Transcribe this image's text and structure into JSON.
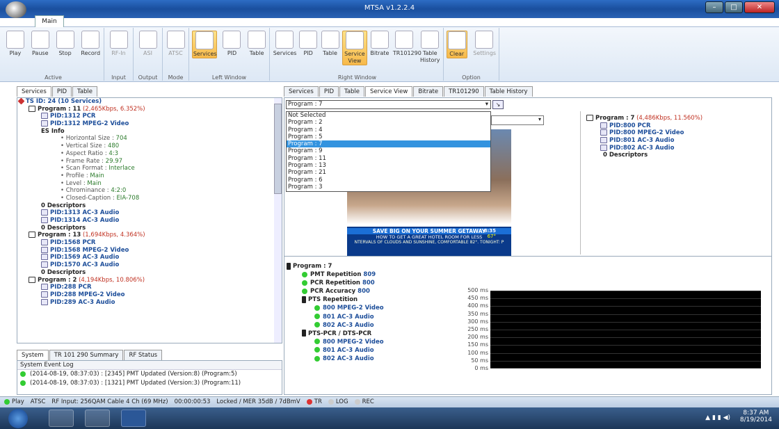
{
  "window": {
    "title": "MTSA v1.2.2.4"
  },
  "ribbon": {
    "main_tab": "Main",
    "groups": [
      {
        "label": "Active",
        "buttons": [
          {
            "label": "Play",
            "icon": "play-icon"
          },
          {
            "label": "Pause",
            "icon": "pause-icon"
          },
          {
            "label": "Stop",
            "icon": "stop-icon"
          },
          {
            "label": "Record",
            "icon": "record-icon"
          }
        ]
      },
      {
        "label": "Input",
        "buttons": [
          {
            "label": "RF-In",
            "icon": "rf-in-icon"
          }
        ]
      },
      {
        "label": "Output",
        "buttons": [
          {
            "label": "ASI",
            "icon": "asi-icon"
          }
        ]
      },
      {
        "label": "Mode",
        "buttons": [
          {
            "label": "ATSC",
            "icon": "atsc-icon"
          }
        ]
      },
      {
        "label": "Left Window",
        "buttons": [
          {
            "label": "Services",
            "icon": "tv-icon"
          },
          {
            "label": "PID",
            "icon": "pid-icon"
          },
          {
            "label": "Table",
            "icon": "table-icon"
          }
        ]
      },
      {
        "label": "Right Window",
        "buttons": [
          {
            "label": "Services",
            "icon": "tv-icon"
          },
          {
            "label": "PID",
            "icon": "pid-icon"
          },
          {
            "label": "Table",
            "icon": "table-icon"
          },
          {
            "label": "Service View",
            "icon": "magnifier-icon"
          },
          {
            "label": "Bitrate",
            "icon": "bar-chart-icon"
          },
          {
            "label": "TR101290",
            "icon": "traffic-light-icon"
          },
          {
            "label": "Table History",
            "icon": "history-icon"
          }
        ]
      },
      {
        "label": "Option",
        "buttons": [
          {
            "label": "Clear",
            "icon": "warning-icon"
          },
          {
            "label": "Settings",
            "icon": "gear-icon"
          }
        ]
      }
    ]
  },
  "left_tabs": [
    "Services",
    "PID",
    "Table"
  ],
  "tree": [
    {
      "t": "TS ID: 24 (10 Services)",
      "k": "ts"
    },
    {
      "t": "Program : 11",
      "r": " (2,465Kbps, 6.352%)",
      "k": "prog"
    },
    {
      "t": "PID:1312 PCR",
      "k": "pid"
    },
    {
      "t": "PID:1312 MPEG-2 Video",
      "k": "pid"
    },
    {
      "t": "ES Info",
      "k": "bold"
    },
    {
      "t": "Horizontal Size : ",
      "v": "704",
      "k": "es"
    },
    {
      "t": "Vertical Size : ",
      "v": "480",
      "k": "es"
    },
    {
      "t": "Aspect Ratio : ",
      "v": "4:3",
      "k": "es"
    },
    {
      "t": "Frame Rate : ",
      "v": "29.97",
      "k": "es"
    },
    {
      "t": "Scan Format : ",
      "v": "Interlace",
      "k": "es"
    },
    {
      "t": "Profile : ",
      "v": "Main",
      "k": "es"
    },
    {
      "t": "Level : ",
      "v": "Main",
      "k": "es"
    },
    {
      "t": "Chrominance : ",
      "v": "4:2:0",
      "k": "es"
    },
    {
      "t": "Closed-Caption : ",
      "v": "EIA-708",
      "k": "es"
    },
    {
      "t": "0 Descriptors",
      "k": "bold"
    },
    {
      "t": "PID:1313 AC-3 Audio",
      "k": "pid"
    },
    {
      "t": "PID:1314 AC-3 Audio",
      "k": "pid"
    },
    {
      "t": "0 Descriptors",
      "k": "bold"
    },
    {
      "t": "Program : 13",
      "r": " (1,694Kbps, 4.364%)",
      "k": "prog"
    },
    {
      "t": "PID:1568 PCR",
      "k": "pid"
    },
    {
      "t": "PID:1568 MPEG-2 Video",
      "k": "pid"
    },
    {
      "t": "PID:1569 AC-3 Audio",
      "k": "pid"
    },
    {
      "t": "PID:1570 AC-3 Audio",
      "k": "pid"
    },
    {
      "t": "0 Descriptors",
      "k": "bold"
    },
    {
      "t": "Program : 2",
      "r": " (4,194Kbps, 10.806%)",
      "k": "prog"
    },
    {
      "t": "PID:288 PCR",
      "k": "pid"
    },
    {
      "t": "PID:288 MPEG-2 Video",
      "k": "pid"
    },
    {
      "t": "PID:289 AC-3 Audio",
      "k": "pid"
    }
  ],
  "log_tabs": [
    "System",
    "TR 101 290 Summary",
    "RF Status"
  ],
  "log_header": "System Event Log",
  "log_rows": [
    "(2014-08-19, 08:37:03) : [2345] PMT Updated (Version:8) (Program:5)",
    "(2014-08-19, 08:37:03) : [1321] PMT Updated (Version:3) (Program:11)"
  ],
  "right_tabs": [
    "Services",
    "PID",
    "Table",
    "Service View",
    "Bitrate",
    "TR101290",
    "Table History"
  ],
  "program_select": {
    "value": "Program : 7",
    "options": [
      "Not Selected",
      "Program : 2",
      "Program : 4",
      "Program : 5",
      "Program : 7",
      "Program : 9",
      "Program : 11",
      "Program : 13",
      "Program : 21",
      "Program : 6",
      "Program : 3"
    ],
    "selected_index": 4
  },
  "video": {
    "banner_line1": "SAVE BIG ON YOUR SUMMER GETAWAY",
    "banner_line2": "HOW TO GET A GREAT HOTEL ROOM FOR LESS",
    "banner_line3": "NTERVALS OF CLOUDS AND SUNSHINE, COMFORTABLE 82°.   TONIGHT: P",
    "time": "8:35",
    "temp": "67°"
  },
  "program_info": [
    {
      "t": "Program : 7",
      "r": " (4,486Kbps, 11.560%)",
      "k": "prog"
    },
    {
      "t": "PID:800 PCR",
      "k": "pid"
    },
    {
      "t": "PID:800 MPEG-2 Video",
      "k": "pid"
    },
    {
      "t": "PID:801 AC-3 Audio",
      "k": "pid"
    },
    {
      "t": "PID:802 AC-3 Audio",
      "k": "pid"
    },
    {
      "t": "0 Descriptors",
      "k": "bold"
    }
  ],
  "tr_tree": [
    {
      "t": "Program : 7",
      "v": ""
    },
    {
      "t": "PMT Repetition ",
      "v": "809"
    },
    {
      "t": "PCR Repetition ",
      "v": "800"
    },
    {
      "t": "PCR Accuracy ",
      "v": "800"
    },
    {
      "t": "PTS Repetition",
      "v": ""
    },
    {
      "t": "",
      "v": "800",
      "s": " MPEG-2 Video"
    },
    {
      "t": "",
      "v": "801",
      "s": " AC-3 Audio"
    },
    {
      "t": "",
      "v": "802",
      "s": " AC-3 Audio"
    },
    {
      "t": "PTS-PCR / DTS-PCR",
      "v": ""
    },
    {
      "t": "",
      "v": "800",
      "s": " MPEG-2 Video"
    },
    {
      "t": "",
      "v": "801",
      "s": " AC-3 Audio"
    },
    {
      "t": "",
      "v": "802",
      "s": " AC-3 Audio"
    }
  ],
  "chart_axis": [
    "500 ms",
    "450 ms",
    "400 ms",
    "350 ms",
    "300 ms",
    "250 ms",
    "200 ms",
    "150 ms",
    "100 ms",
    "50 ms",
    "0 ms"
  ],
  "statusbar": [
    "Play",
    "ATSC",
    "RF Input: 256QAM Cable 4 Ch (69 MHz)",
    "00:00:00:53",
    "Locked / MER 35dB / 7dBmV",
    "TR",
    "LOG",
    "REC"
  ],
  "clock": {
    "time": "8:37 AM",
    "date": "8/19/2014"
  }
}
